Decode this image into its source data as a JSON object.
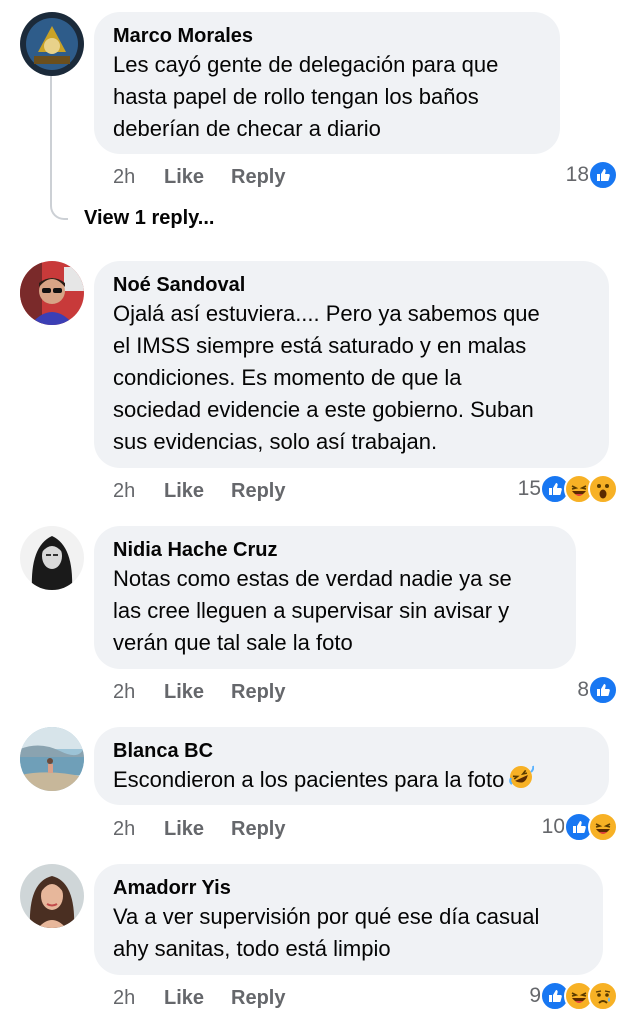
{
  "thread": {
    "view_replies": "View 1 reply..."
  },
  "comments": [
    {
      "author": "Marco Morales",
      "text": "Les cayó gente de delegación para que\nhasta papel de rollo tengan los baños\ndeberían de checar a diario",
      "time": "2h",
      "like": "Like",
      "reply": "Reply",
      "count": "18",
      "reactions": [
        "like-icon"
      ]
    },
    {
      "author": "Noé Sandoval",
      "text": "Ojalá así estuviera.... Pero ya sabemos que\nel IMSS siempre está saturado y en malas\ncondiciones. Es momento de que la\nsociedad evidencie a este gobierno.  Suban\nsus evidencias, solo así trabajan.",
      "time": "2h",
      "like": "Like",
      "reply": "Reply",
      "count": "15",
      "reactions": [
        "like-icon",
        "haha-icon",
        "wow-icon"
      ]
    },
    {
      "author": "Nidia Hache Cruz",
      "text": "Notas como estas de verdad nadie ya se\nlas cree lleguen a supervisar sin avisar y\nverán que tal sale la foto",
      "time": "2h",
      "like": "Like",
      "reply": "Reply",
      "count": "8",
      "reactions": [
        "like-icon"
      ]
    },
    {
      "author": "Blanca BC",
      "text": "Escondieron a los pacientes para la foto",
      "emoji": "rolling-laughing-emoji",
      "time": "2h",
      "like": "Like",
      "reply": "Reply",
      "count": "10",
      "reactions": [
        "like-icon",
        "haha-icon"
      ]
    },
    {
      "author": "Amadorr Yis",
      "text": "Va a ver supervisión por qué ese día casual\nahy sanitas, todo está limpio",
      "time": "2h",
      "like": "Like",
      "reply": "Reply",
      "count": "9",
      "reactions": [
        "like-icon",
        "haha-icon",
        "sad-icon"
      ]
    }
  ],
  "colors": {
    "bubble": "#f0f2f5",
    "like_blue": "#1877f2",
    "meta_gray": "#65676b",
    "reaction_yellow": "#f7b125"
  }
}
